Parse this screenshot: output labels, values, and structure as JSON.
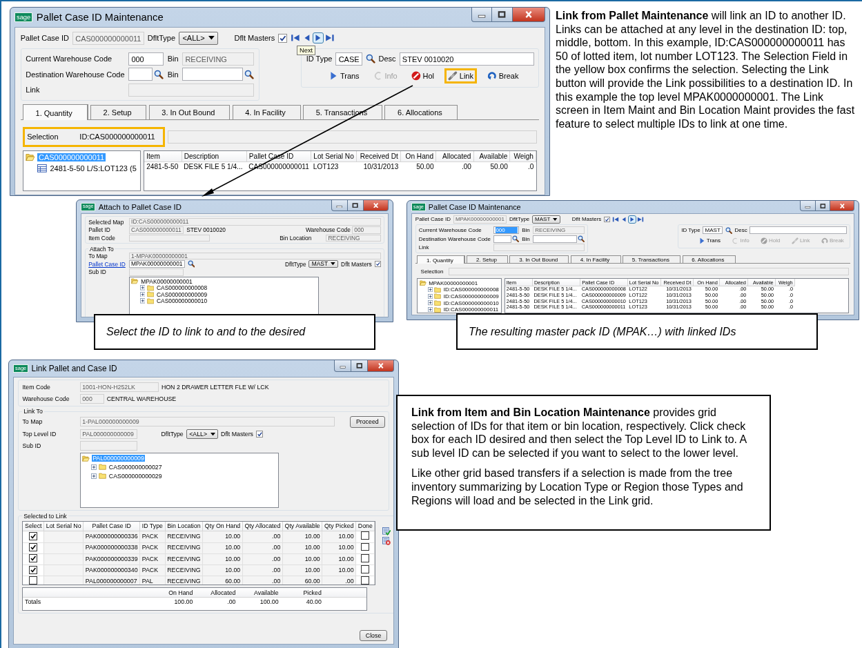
{
  "windows": [
    {
      "kind": "pallet_maintenance",
      "logo": "sage",
      "title": "Pallet Case ID Maintenance",
      "pallet_case_id_label": "Pallet Case ID",
      "pallet_case_id": "CAS000000000011",
      "dflttype_label": "DfltType",
      "dflttype": "<ALL>",
      "dflt_masters_label": "Dflt Masters",
      "dflt_masters_checked": true,
      "tooltip": "Next",
      "current_warehouse_label": "Current Warehouse Code",
      "current_warehouse": "000",
      "current_warehouse_highlighted": false,
      "bin_label": "Bin",
      "bin": "RECEIVING",
      "destination_warehouse_label": "Destination Warehouse Code",
      "destination_bin_label": "Bin",
      "link_label": "Link",
      "id_type_label": "ID Type",
      "id_type": "CASE",
      "desc_label": "Desc",
      "desc": "STEV 0010020",
      "actions": [
        {
          "kind": "trans",
          "label": "Trans",
          "disabled": false,
          "highlighted": false
        },
        {
          "kind": "info",
          "label": "Info",
          "disabled": true,
          "highlighted": false
        },
        {
          "kind": "hold",
          "label": "Hol",
          "disabled": false,
          "highlighted": false
        },
        {
          "kind": "link",
          "label": "Link",
          "disabled": false,
          "highlighted": true
        },
        {
          "kind": "break",
          "label": "Break",
          "disabled": false,
          "highlighted": false
        }
      ],
      "tabs": [
        {
          "label": "1. Quantity",
          "selected": true
        },
        {
          "label": "2. Setup",
          "selected": false
        },
        {
          "label": "3. In Out Bound",
          "selected": false
        },
        {
          "label": "4. In Facility",
          "selected": false
        },
        {
          "label": "5. Transactions",
          "selected": false
        },
        {
          "label": "6. Allocations",
          "selected": false
        }
      ],
      "selection_label": "Selection",
      "selection": "ID:CAS000000000011",
      "selection_highlighted": true,
      "tree": [
        {
          "kind": "folder",
          "label": "CAS000000000011",
          "expanded": true,
          "selected": true,
          "children": [
            {
              "kind": "item",
              "label": "2481-5-50 L/S:LOT123 (5",
              "selected": false
            }
          ]
        }
      ],
      "grid": {
        "columns": [
          {
            "label": "Item",
            "kind": "text"
          },
          {
            "label": "Description",
            "kind": "text"
          },
          {
            "label": "Pallet Case ID",
            "kind": "text"
          },
          {
            "label": "Lot Serial No",
            "kind": "text"
          },
          {
            "label": "Received Dt",
            "kind": "number"
          },
          {
            "label": "On Hand",
            "kind": "number"
          },
          {
            "label": "Allocated",
            "kind": "number"
          },
          {
            "label": "Available",
            "kind": "number"
          },
          {
            "label": "Weigh",
            "kind": "number"
          }
        ],
        "rows": [
          [
            "2481-5-50",
            "DESK FILE 5 1/4...",
            "CAS000000000011",
            "LOT123",
            "10/31/2013",
            "50.00",
            ".00",
            "50.00",
            ".0"
          ]
        ]
      }
    },
    {
      "kind": "attach",
      "logo": "sage",
      "title": "Attach to Pallet Case ID",
      "selected_map_label": "Selected Map",
      "selected_map": "ID:CAS000000000011",
      "pallet_id_label": "Pallet ID",
      "pallet_id": "CAS000000000011",
      "pallet_desc": "STEV 0010020",
      "warehouse_code_label": "Warehouse Code",
      "warehouse_code": "000",
      "item_code_label": "Item Code",
      "bin_location_label": "Bin Location",
      "bin_location": "RECEIVING",
      "attach_to_legend": "Attach To",
      "to_map_label": "To Map",
      "to_map": "1-MPAK00000000001",
      "pallet_case_id_link": "Pallet Case ID",
      "pallet_case_id": "MPAK00000000001",
      "dflttype_label": "DfltType",
      "dflttype": "MAST",
      "dflt_masters_label": "Dflt Masters",
      "dflt_masters_checked": true,
      "sub_id_label": "Sub ID",
      "tree": [
        {
          "kind": "folder",
          "label": "MPAK00000000001",
          "expanded": true,
          "selected": false,
          "children": [
            {
              "kind": "folder",
              "label": "CAS000000000008",
              "expanded": false,
              "selected": false
            },
            {
              "kind": "folder",
              "label": "CAS000000000009",
              "expanded": false,
              "selected": false
            },
            {
              "kind": "folder",
              "label": "CAS000000000010",
              "expanded": false,
              "selected": false
            }
          ]
        }
      ]
    },
    {
      "kind": "pallet_maintenance",
      "logo": "sage",
      "title": "Pallet Case ID Maintenance",
      "pallet_case_id_label": "Pallet Case ID",
      "pallet_case_id": "MPAK00000000001",
      "dflttype_label": "DfltType",
      "dflttype": "MAST",
      "dflt_masters_label": "Dflt Masters",
      "dflt_masters_checked": true,
      "current_warehouse_label": "Current Warehouse Code",
      "current_warehouse": "000",
      "current_warehouse_highlighted": true,
      "bin_label": "Bin",
      "bin": "RECEIVING",
      "destination_warehouse_label": "Destination Warehouse Code",
      "destination_bin_label": "Bin",
      "link_label": "Link",
      "id_type_label": "ID Type",
      "id_type": "MAST",
      "desc_label": "Desc",
      "actions": [
        {
          "kind": "trans",
          "label": "Trans",
          "disabled": false,
          "highlighted": false
        },
        {
          "kind": "info",
          "label": "Info",
          "disabled": true,
          "highlighted": false
        },
        {
          "kind": "hold",
          "label": "Hold",
          "disabled": true,
          "highlighted": false
        },
        {
          "kind": "link",
          "label": "Link",
          "disabled": true,
          "highlighted": false
        },
        {
          "kind": "break",
          "label": "Break",
          "disabled": true,
          "highlighted": false
        }
      ],
      "tabs": [
        {
          "label": "1. Quantity",
          "selected": true
        },
        {
          "label": "2. Setup",
          "selected": false
        },
        {
          "label": "3. In Out Bound",
          "selected": false
        },
        {
          "label": "4. In Facility",
          "selected": false
        },
        {
          "label": "5. Transactions",
          "selected": false
        },
        {
          "label": "6. Allocations",
          "selected": false
        }
      ],
      "selection_label": "Selection",
      "selection_highlighted": false,
      "tree": [
        {
          "kind": "folder",
          "label": "MPAK00000000001",
          "expanded": true,
          "selected": false,
          "children": [
            {
              "kind": "folder",
              "label": "ID:CAS000000000008",
              "expanded": false,
              "selected": false
            },
            {
              "kind": "folder",
              "label": "ID:CAS000000000009",
              "expanded": false,
              "selected": false
            },
            {
              "kind": "folder",
              "label": "ID:CAS000000000010",
              "expanded": false,
              "selected": false
            },
            {
              "kind": "folder",
              "label": "ID:CAS000000000011",
              "expanded": false,
              "selected": false
            }
          ]
        }
      ],
      "grid": {
        "columns": [
          {
            "label": "Item",
            "kind": "text"
          },
          {
            "label": "Description",
            "kind": "text"
          },
          {
            "label": "Pallet Case ID",
            "kind": "text"
          },
          {
            "label": "Lot Serial No",
            "kind": "text"
          },
          {
            "label": "Received Dt",
            "kind": "number"
          },
          {
            "label": "On Hand",
            "kind": "number"
          },
          {
            "label": "Allocated",
            "kind": "number"
          },
          {
            "label": "Available",
            "kind": "number"
          },
          {
            "label": "Weigh",
            "kind": "number"
          }
        ],
        "rows": [
          [
            "2481-5-50",
            "DESK FILE 5 1/4...",
            "CAS000000000008",
            "LOT122",
            "10/31/2013",
            "50.00",
            ".00",
            "50.00",
            ".0"
          ],
          [
            "2481-5-50",
            "DESK FILE 5 1/4...",
            "CAS000000000009",
            "LOT122",
            "10/31/2013",
            "50.00",
            ".00",
            "50.00",
            ".0"
          ],
          [
            "2481-5-50",
            "DESK FILE 5 1/4...",
            "CAS000000000010",
            "LOT123",
            "10/31/2013",
            "50.00",
            ".00",
            "50.00",
            ".0"
          ],
          [
            "2481-5-50",
            "DESK FILE 5 1/4...",
            "CAS000000000011",
            "LOT123",
            "10/31/2013",
            "50.00",
            ".00",
            "50.00",
            ".0"
          ]
        ]
      }
    },
    {
      "kind": "link_pallet",
      "logo": "sage",
      "title": "Link Pallet and Case ID",
      "item_code_label": "Item Code",
      "item_code": "1001-HON-H252LK",
      "item_desc": "HON 2 DRAWER LETTER FLE W/ LCK",
      "warehouse_code_label": "Warehouse Code",
      "warehouse_code": "000",
      "warehouse_desc": "CENTRAL WAREHOUSE",
      "link_to_legend": "Link To",
      "to_map_label": "To Map",
      "to_map": "1-PAL000000000009",
      "proceed_button": "Proceed",
      "top_level_id_label": "Top Level ID",
      "top_level_id": "PAL000000000009",
      "dflttype_label": "DfltType",
      "dflttype": "<ALL>",
      "dflt_masters_label": "Dflt Masters",
      "dflt_masters_checked": true,
      "sub_id_label": "Sub ID",
      "tree": [
        {
          "kind": "folder",
          "label": "PAL000000000009",
          "expanded": true,
          "selected": true,
          "children": [
            {
              "kind": "folder",
              "label": "CAS000000000027",
              "expanded": false,
              "selected": false
            },
            {
              "kind": "folder",
              "label": "CAS000000000029",
              "expanded": false,
              "selected": false
            }
          ]
        }
      ],
      "selected_to_link_legend": "Selected to Link",
      "grid": {
        "columns": [
          {
            "label": "Select",
            "kind": "check"
          },
          {
            "label": "Lot Serial No",
            "kind": "text"
          },
          {
            "label": "Pallet Case ID",
            "kind": "text"
          },
          {
            "label": "ID Type",
            "kind": "text"
          },
          {
            "label": "Bin Location",
            "kind": "text"
          },
          {
            "label": "Qty On Hand",
            "kind": "number"
          },
          {
            "label": "Qty Allocated",
            "kind": "number"
          },
          {
            "label": "Qty Available",
            "kind": "number"
          },
          {
            "label": "Qty Picked",
            "kind": "number"
          },
          {
            "label": "Done",
            "kind": "check"
          }
        ],
        "rows": [
          {
            "cells": [
              {
                "checked": true
              },
              "",
              "PAK000000000336",
              "PACK",
              "RECEIVING",
              "10.00",
              ".00",
              "10.00",
              "10.00",
              {
                "checked": false
              }
            ]
          },
          {
            "cells": [
              {
                "checked": true
              },
              "",
              "PAK000000000338",
              "PACK",
              "RECEIVING",
              "10.00",
              ".00",
              "10.00",
              "10.00",
              {
                "checked": false
              }
            ]
          },
          {
            "cells": [
              {
                "checked": true
              },
              "",
              "PAK000000000339",
              "PACK",
              "RECEIVING",
              "10.00",
              ".00",
              "10.00",
              "10.00",
              {
                "checked": false
              }
            ]
          },
          {
            "cells": [
              {
                "checked": true
              },
              "",
              "PAK000000000340",
              "PACK",
              "RECEIVING",
              "10.00",
              ".00",
              "10.00",
              "10.00",
              {
                "checked": false
              }
            ]
          },
          {
            "cells": [
              {
                "checked": false
              },
              "",
              "PAL000000000007",
              "PAL",
              "RECEIVING",
              "60.00",
              ".00",
              "60.00",
              ".00",
              {
                "checked": false
              }
            ]
          }
        ]
      },
      "totals": {
        "headers": [
          "On Hand",
          "Allocated",
          "Available",
          "Picked"
        ],
        "label": "Totals",
        "values": [
          "100.00",
          ".00",
          "100.00",
          "40.00"
        ]
      },
      "close_button": "Close"
    }
  ],
  "captions": [
    "Select the ID to link to and to the desired",
    "The resulting master pack ID (MPAK…) with linked IDs"
  ],
  "description": "**Link from Pallet Maintenance** will link an ID to another ID.  Links can be attached at any level in the destination ID: top, middle, bottom.  In this example, ID:CAS000000000011 has 50 of lotted item, lot number LOT123.  The Selection Field in the yellow box confirms the selection.  Selecting the Link button will provide the Link possibilities to a destination ID.  In this example the top level MPAK0000000001.  The Link screen in Item Maint and Bin Location Maint provides the fast feature to select multiple IDs to link at one time.",
  "callout": [
    "**Link from Item and Bin Location Maintenance** provides grid selection of IDs for that item or bin location, respectively.   Click check box for each ID desired and then select the Top Level ID to Link to.  A sub level ID can be selected if you want to select to the lower level.",
    "Like other grid based transfers if a selection is made from the tree inventory summarizing by Location Type or Region those Types and Regions will load and be selected in the Link grid."
  ]
}
